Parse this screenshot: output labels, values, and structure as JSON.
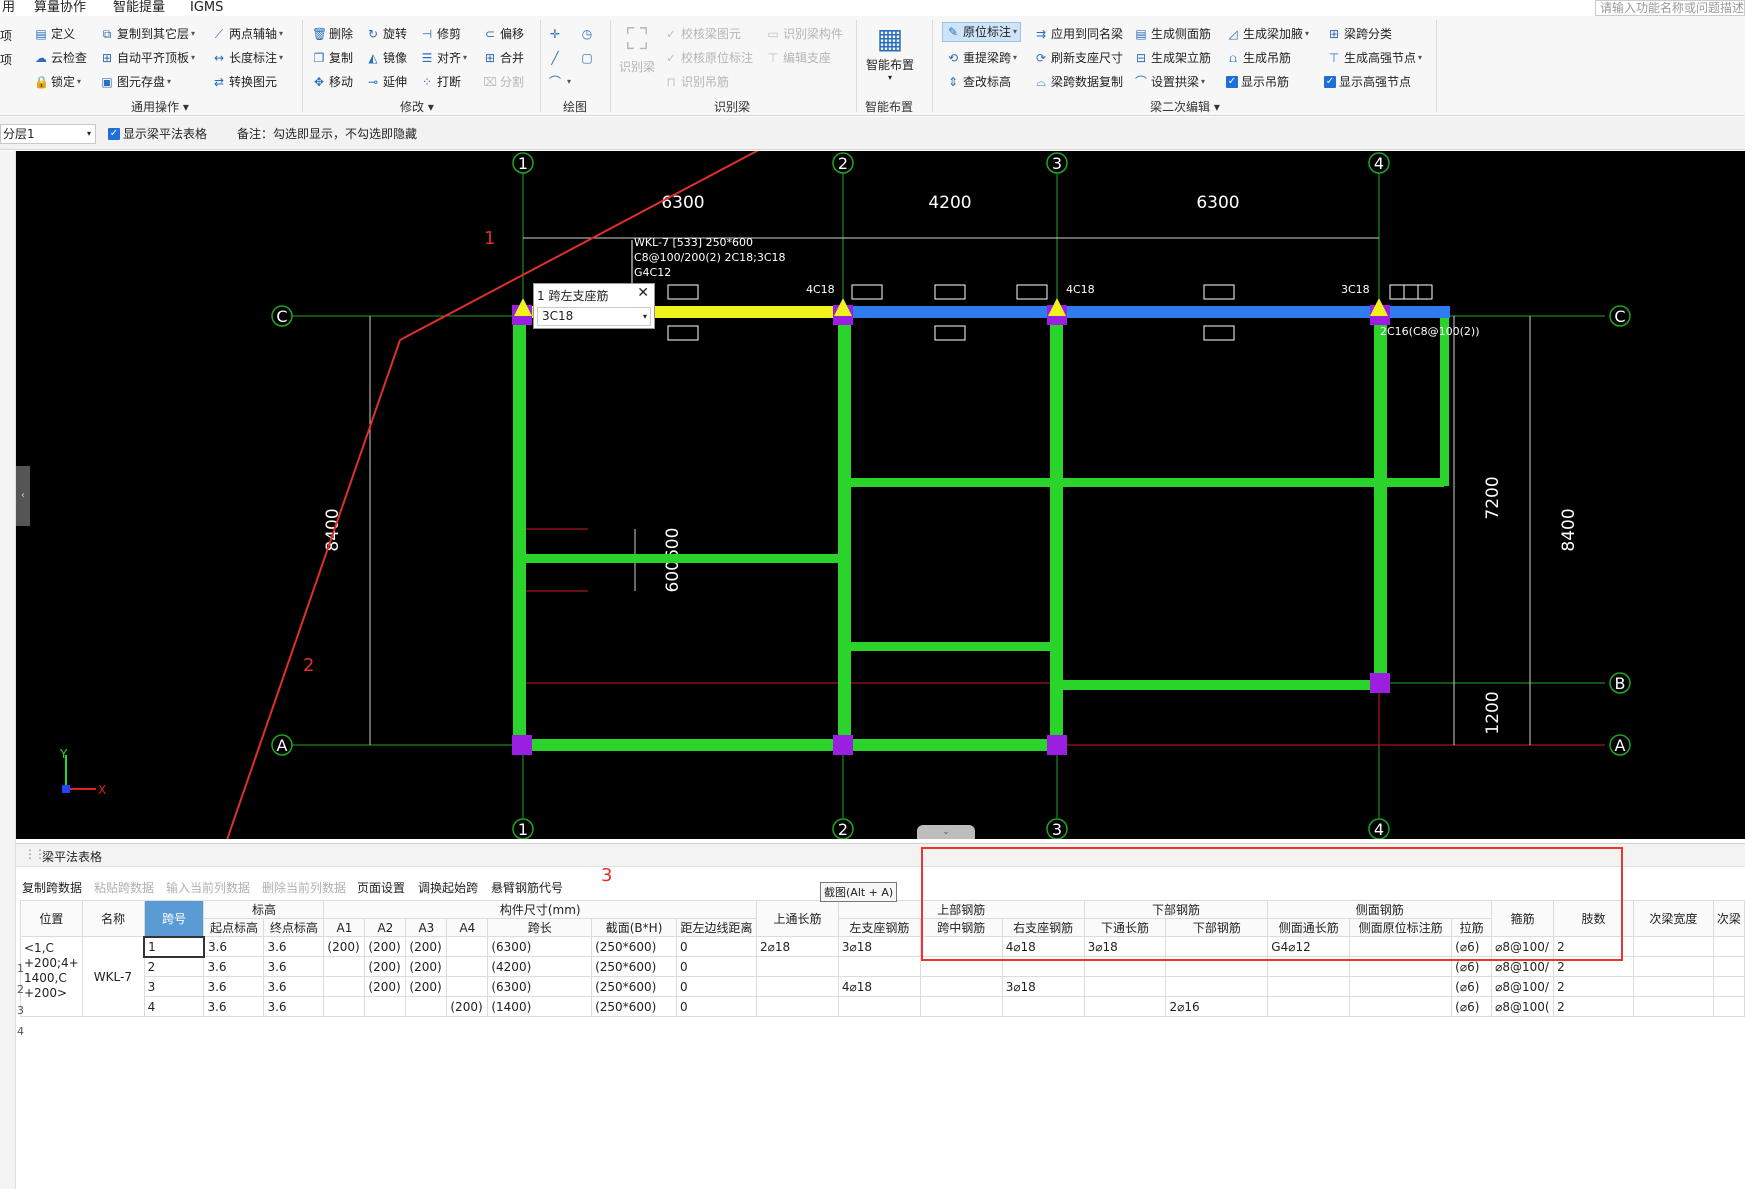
{
  "menubar": {
    "items": [
      "用",
      "算量协作",
      "智能提量",
      "IGMS"
    ],
    "search_placeholder": "请输入功能名称或问题描述"
  },
  "ribbon": {
    "left_stub": [
      "项",
      "项"
    ],
    "general_ops": {
      "buttons": [
        "定义",
        "复制到其它层",
        "两点辅轴",
        "云检查",
        "自动平齐顶板",
        "长度标注",
        "锁定",
        "图元存盘",
        "转换图元"
      ],
      "label": "通用操作"
    },
    "modify": {
      "buttons": [
        "删除",
        "旋转",
        "修剪",
        "偏移",
        "复制",
        "镜像",
        "对齐",
        "合并",
        "移动",
        "延伸",
        "打断",
        "分割"
      ],
      "label": "修改"
    },
    "draw": {
      "label": "绘图"
    },
    "recognize": {
      "buttons": [
        "识别梁",
        "校核梁图元",
        "识别梁构件",
        "校核原位标注",
        "编辑支座",
        "识别吊筋"
      ],
      "label": "识别梁"
    },
    "smart": {
      "button": "智能布置",
      "label": "智能布置"
    },
    "beam_edit": {
      "buttons": [
        "原位标注",
        "应用到同名梁",
        "生成侧面筋",
        "生成梁加腋",
        "梁跨分类",
        "重提梁跨",
        "刷新支座尺寸",
        "生成架立筋",
        "生成吊筋",
        "生成高强节点",
        "查改标高",
        "梁跨数据复制",
        "设置拱梁",
        "显示吊筋",
        "显示高强节点"
      ],
      "label": "梁二次编辑"
    }
  },
  "optbar": {
    "layer": "分层1",
    "show_table": "显示梁平法表格",
    "note": "备注：勾选即显示，不勾选即隐藏"
  },
  "canvas": {
    "axes_top": [
      "1",
      "2",
      "3",
      "4"
    ],
    "axes_side": [
      "C",
      "B",
      "A"
    ],
    "dims_top": [
      "6300",
      "4200",
      "6300"
    ],
    "dims_left": "8400",
    "dims_right_inner": [
      "7200",
      "1200"
    ],
    "dims_right_outer": "8400",
    "dim_mid": "600600",
    "beam_label": [
      "WKL-7 [533] 250*600",
      "C8@100/200(2) 2C18;3C18",
      "G4C12"
    ],
    "rebar_tags": [
      "4C18",
      "4C18",
      "3C18",
      "2C16(C8@100(2))"
    ],
    "annotations": [
      "1",
      "2",
      "3"
    ],
    "popup": {
      "title": "1 跨左支座筋",
      "value": "3C18"
    },
    "ucs": {
      "x": "X",
      "y": "Y"
    }
  },
  "panel": {
    "title": "梁平法表格",
    "tools": [
      "复制跨数据",
      "粘贴跨数据",
      "输入当前列数据",
      "删除当前列数据",
      "页面设置",
      "调换起始跨",
      "悬臂钢筋代号"
    ],
    "tooltip": "截图(Alt + A)",
    "groups": [
      "标高",
      "构件尺寸(mm)",
      "上部钢筋",
      "下部钢筋",
      "侧面钢筋"
    ],
    "headers": [
      "位置",
      "名称",
      "跨号",
      "起点标高",
      "终点标高",
      "A1",
      "A2",
      "A3",
      "A4",
      "跨长",
      "截面(B*H)",
      "距左边线距离",
      "上通长筋",
      "左支座钢筋",
      "跨中钢筋",
      "右支座钢筋",
      "下通长筋",
      "下部钢筋",
      "侧面通长筋",
      "侧面原位标注筋",
      "拉筋",
      "箍筋",
      "肢数",
      "次梁宽度",
      "次梁"
    ],
    "position": "<1,C +200;4+ 1400,C +200>",
    "name": "WKL-7",
    "rows": [
      [
        "1",
        "3.6",
        "3.6",
        "(200)",
        "(200)",
        "(200)",
        "",
        "(6300)",
        "(250*600)",
        "0",
        "2⌀18",
        "3⌀18",
        "",
        "4⌀18",
        "3⌀18",
        "",
        "G4⌀12",
        "",
        "(⌀6)",
        "⌀8@100/",
        "2",
        "",
        ""
      ],
      [
        "2",
        "3.6",
        "3.6",
        "",
        "(200)",
        "(200)",
        "",
        "(4200)",
        "(250*600)",
        "0",
        "",
        "",
        "",
        "",
        "",
        "",
        "",
        "",
        "(⌀6)",
        "⌀8@100/",
        "2",
        "",
        ""
      ],
      [
        "3",
        "3.6",
        "3.6",
        "",
        "(200)",
        "(200)",
        "",
        "(6300)",
        "(250*600)",
        "0",
        "",
        "4⌀18",
        "",
        "3⌀18",
        "",
        "",
        "",
        "",
        "(⌀6)",
        "⌀8@100/",
        "2",
        "",
        ""
      ],
      [
        "4",
        "3.6",
        "3.6",
        "",
        "",
        "",
        "(200)",
        "(1400)",
        "(250*600)",
        "0",
        "",
        "",
        "",
        "",
        "",
        "2⌀16",
        "",
        "",
        "(⌀6)",
        "⌀8@100(",
        "2",
        "",
        ""
      ]
    ],
    "row_numbers": [
      "1",
      "2",
      "3",
      "4"
    ]
  }
}
